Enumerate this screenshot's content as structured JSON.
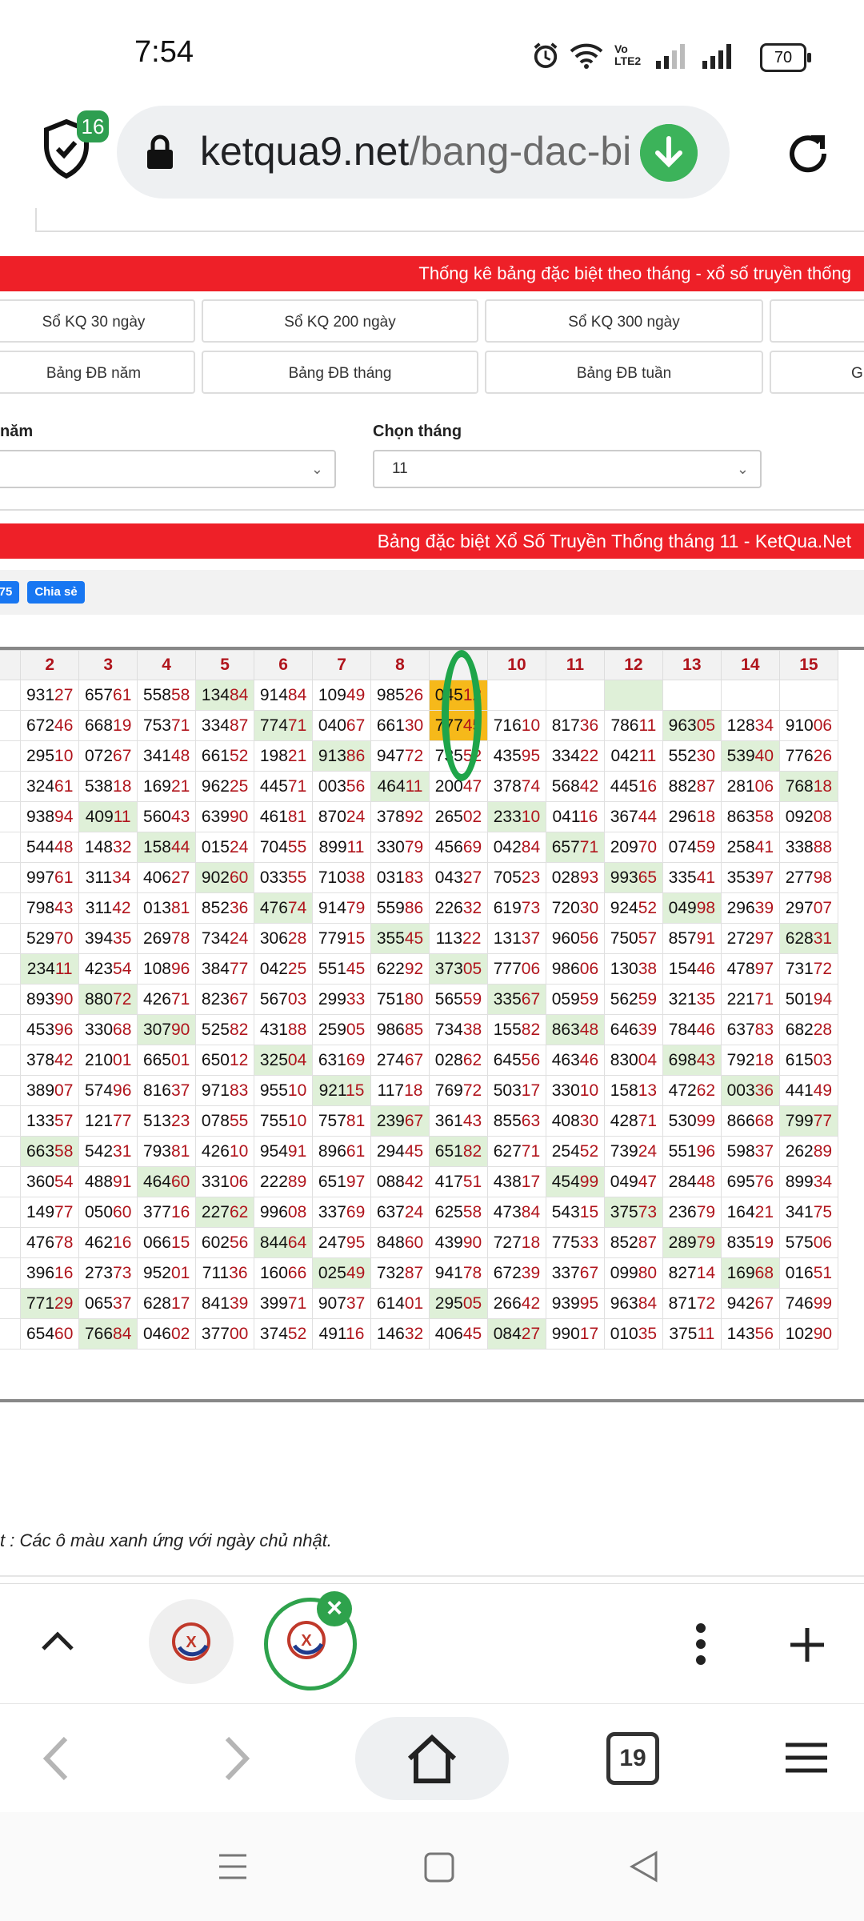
{
  "status": {
    "time": "7:54",
    "battery": "70",
    "volte": "Vo LTE2"
  },
  "browser": {
    "shield_badge": "16",
    "url_host": "ketqua9.net",
    "url_path": "/bang-dac-bie",
    "tab_count": "19"
  },
  "page": {
    "banner1": "Thống kê bảng đặc biệt theo tháng - xổ số truyền thống",
    "buttons_row1": [
      "Sổ KQ 30 ngày",
      "Sổ KQ 200 ngày",
      "Sổ KQ 300 ngày"
    ],
    "buttons_row2": [
      "Bảng ĐB năm",
      "Bảng ĐB tháng",
      "Bảng ĐB tuần",
      "Gi"
    ],
    "year_label": "năm",
    "month_label": "Chọn tháng",
    "month_value": "11",
    "banner2": "Bảng đặc biệt Xổ Số Truyền Thống tháng 11 - KetQua.Net",
    "like_count": "75",
    "share_label": "Chia sẻ",
    "note": "t : Các ô màu xanh ứng với ngày chủ nhật."
  },
  "table": {
    "headers": [
      "",
      "2",
      "3",
      "4",
      "5",
      "6",
      "7",
      "8",
      "",
      "10",
      "11",
      "12",
      "13",
      "14",
      "15"
    ],
    "rows": [
      [
        "",
        "93127",
        "65761",
        "55858",
        "13484",
        "91484",
        "10949",
        "98526",
        "04512",
        "",
        "",
        "",
        "",
        "",
        ""
      ],
      [
        "",
        "67246",
        "66819",
        "75371",
        "33487",
        "77471",
        "04067",
        "66130",
        "77745",
        "71610",
        "81736",
        "78611",
        "96305",
        "12834",
        "91006"
      ],
      [
        "",
        "29510",
        "07267",
        "34148",
        "66152",
        "19821",
        "91386",
        "94772",
        "73552",
        "43595",
        "33422",
        "04211",
        "55230",
        "53940",
        "77626"
      ],
      [
        "",
        "32461",
        "53818",
        "16921",
        "96225",
        "44571",
        "00356",
        "46411",
        "20047",
        "37874",
        "56842",
        "44516",
        "88287",
        "28106",
        "76818"
      ],
      [
        "",
        "93894",
        "40911",
        "56043",
        "63990",
        "46181",
        "87024",
        "37892",
        "26502",
        "23310",
        "04116",
        "36744",
        "29618",
        "86358",
        "09208"
      ],
      [
        "",
        "54448",
        "14832",
        "15844",
        "01524",
        "70455",
        "89911",
        "33079",
        "45669",
        "04284",
        "65771",
        "20970",
        "07459",
        "25841",
        "33888"
      ],
      [
        "",
        "99761",
        "31134",
        "40627",
        "90260",
        "03355",
        "71038",
        "03183",
        "04327",
        "70523",
        "02893",
        "99365",
        "33541",
        "35397",
        "27798"
      ],
      [
        "",
        "79843",
        "31142",
        "01381",
        "85236",
        "47674",
        "91479",
        "55986",
        "22632",
        "61973",
        "72030",
        "92452",
        "04998",
        "29639",
        "29707"
      ],
      [
        "",
        "52970",
        "39435",
        "26978",
        "73424",
        "30628",
        "77915",
        "35545",
        "11322",
        "13137",
        "96056",
        "75057",
        "85791",
        "27297",
        "62831"
      ],
      [
        "",
        "23411",
        "42354",
        "10896",
        "38477",
        "04225",
        "55145",
        "62292",
        "37305",
        "77706",
        "98606",
        "13038",
        "15446",
        "47897",
        "73172"
      ],
      [
        "",
        "89390",
        "88072",
        "42671",
        "82367",
        "56703",
        "29933",
        "75180",
        "56559",
        "33567",
        "05959",
        "56259",
        "32135",
        "22171",
        "50194"
      ],
      [
        "",
        "45396",
        "33068",
        "30790",
        "52582",
        "43188",
        "25905",
        "98685",
        "73438",
        "15582",
        "86348",
        "64639",
        "78446",
        "63783",
        "68228"
      ],
      [
        "",
        "37842",
        "21001",
        "66501",
        "65012",
        "32504",
        "63169",
        "27467",
        "02862",
        "64556",
        "46346",
        "83004",
        "69843",
        "79218",
        "61503"
      ],
      [
        "",
        "38907",
        "57496",
        "81637",
        "97183",
        "95510",
        "92115",
        "11718",
        "76972",
        "50317",
        "33010",
        "15813",
        "47262",
        "00336",
        "44149"
      ],
      [
        "",
        "13357",
        "12177",
        "51323",
        "07855",
        "75510",
        "75781",
        "23967",
        "36143",
        "85563",
        "40830",
        "42871",
        "53099",
        "86668",
        "79977"
      ],
      [
        "",
        "66358",
        "54231",
        "79381",
        "42610",
        "95491",
        "89661",
        "29445",
        "65182",
        "62771",
        "25452",
        "73924",
        "55196",
        "59837",
        "26289"
      ],
      [
        "",
        "36054",
        "48891",
        "46460",
        "33106",
        "22289",
        "65197",
        "08842",
        "41751",
        "43817",
        "45499",
        "04947",
        "28448",
        "69576",
        "89934"
      ],
      [
        "",
        "14977",
        "05060",
        "37716",
        "22762",
        "99608",
        "33769",
        "63724",
        "62558",
        "47384",
        "54315",
        "37573",
        "23679",
        "16421",
        "34175"
      ],
      [
        "",
        "47678",
        "46216",
        "06615",
        "60256",
        "84464",
        "24795",
        "84860",
        "43990",
        "72718",
        "77533",
        "85287",
        "28979",
        "83519",
        "57506"
      ],
      [
        "",
        "39616",
        "27373",
        "95201",
        "71136",
        "16066",
        "02549",
        "73287",
        "94178",
        "67239",
        "33767",
        "09980",
        "82714",
        "16968",
        "01651"
      ],
      [
        "",
        "77129",
        "06537",
        "62817",
        "84139",
        "39971",
        "90737",
        "61401",
        "29505",
        "26642",
        "93995",
        "96384",
        "87172",
        "94267",
        "74699"
      ],
      [
        "",
        "65460",
        "76684",
        "04602",
        "37700",
        "37452",
        "49116",
        "14632",
        "40645",
        "08427",
        "99017",
        "01035",
        "37511",
        "14356",
        "10290"
      ]
    ],
    "green_cells": [
      [
        0,
        4
      ],
      [
        0,
        11
      ],
      [
        1,
        5
      ],
      [
        1,
        12
      ],
      [
        2,
        6
      ],
      [
        2,
        13
      ],
      [
        3,
        7
      ],
      [
        3,
        14
      ],
      [
        4,
        2
      ],
      [
        4,
        9
      ],
      [
        5,
        3
      ],
      [
        5,
        10
      ],
      [
        6,
        4
      ],
      [
        6,
        11
      ],
      [
        7,
        5
      ],
      [
        7,
        12
      ],
      [
        8,
        7
      ],
      [
        8,
        14
      ],
      [
        9,
        1
      ],
      [
        9,
        8
      ],
      [
        10,
        2
      ],
      [
        10,
        9
      ],
      [
        11,
        3
      ],
      [
        11,
        10
      ],
      [
        12,
        5
      ],
      [
        12,
        12
      ],
      [
        13,
        6
      ],
      [
        13,
        13
      ],
      [
        14,
        7
      ],
      [
        14,
        14
      ],
      [
        15,
        1
      ],
      [
        15,
        8
      ],
      [
        16,
        3
      ],
      [
        16,
        10
      ],
      [
        17,
        4
      ],
      [
        17,
        11
      ],
      [
        18,
        5
      ],
      [
        18,
        12
      ],
      [
        19,
        6
      ],
      [
        19,
        13
      ],
      [
        20,
        1
      ],
      [
        20,
        8
      ],
      [
        21,
        2
      ],
      [
        21,
        9
      ]
    ],
    "yellow_cells": [
      [
        0,
        8
      ],
      [
        1,
        8
      ]
    ]
  },
  "colors": {
    "red": "#ee2028",
    "green_cell": "#dff0d8",
    "highlight": "#f6b91a",
    "accent_green": "#2ea24c"
  }
}
